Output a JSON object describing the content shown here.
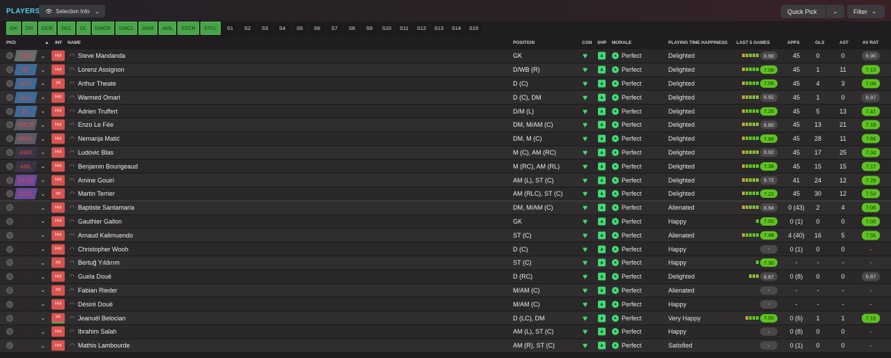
{
  "title": "PLAYERS",
  "selection_info": "Selection Info",
  "quick_pick": "Quick Pick",
  "filter": "Filter",
  "tabs": [
    {
      "label": "GK",
      "kind": "pos"
    },
    {
      "label": "DR",
      "kind": "pos"
    },
    {
      "label": "DCR",
      "kind": "pos"
    },
    {
      "label": "DCL",
      "kind": "pos"
    },
    {
      "label": "DL",
      "kind": "pos"
    },
    {
      "label": "DMCR",
      "kind": "pos"
    },
    {
      "label": "DMCL",
      "kind": "pos"
    },
    {
      "label": "AMR",
      "kind": "pos"
    },
    {
      "label": "AML",
      "kind": "pos"
    },
    {
      "label": "STCR",
      "kind": "pos"
    },
    {
      "label": "STCL",
      "kind": "pos"
    },
    {
      "label": "S1",
      "kind": "slot"
    },
    {
      "label": "S2",
      "kind": "slot"
    },
    {
      "label": "S3",
      "kind": "slot"
    },
    {
      "label": "S4",
      "kind": "slot"
    },
    {
      "label": "S5",
      "kind": "slot"
    },
    {
      "label": "S6",
      "kind": "slot"
    },
    {
      "label": "S7",
      "kind": "slot"
    },
    {
      "label": "S8",
      "kind": "slot"
    },
    {
      "label": "S9",
      "kind": "slot"
    },
    {
      "label": "S10",
      "kind": "slot"
    },
    {
      "label": "S11",
      "kind": "slot"
    },
    {
      "label": "S12",
      "kind": "slot"
    },
    {
      "label": "S13",
      "kind": "slot"
    },
    {
      "label": "S14",
      "kind": "slot"
    },
    {
      "label": "S15",
      "kind": "slot"
    }
  ],
  "headers": {
    "pkd": "PKD",
    "inf": "INF",
    "name": "NAME",
    "position": "POSITION",
    "con": "CON",
    "shp": "SHP",
    "morale": "MORALE",
    "happiness": "PLAYING TIME HAPPINESS",
    "last5": "LAST 5 GAMES",
    "apps": "APPS",
    "gls": "GLS",
    "ast": "AST",
    "avrat": "AV RAT"
  },
  "colors": {
    "pos_tab": "#47a447",
    "rating_green": "#5dc41f",
    "rating_grey": "#4a484a",
    "heart": "#3ddc74",
    "inf_red": "#d9534f",
    "accent": "#4fd1e8"
  },
  "players": [
    {
      "pkd": "GK",
      "pkd_color": "#6a6a6a",
      "inf": "Hol",
      "name": "Steve Mandanda",
      "position": "GK",
      "morale": "Perfect",
      "happiness": "Delighted",
      "bars": 5,
      "last5": "6.90",
      "last5_green": false,
      "apps": "45",
      "gls": "0",
      "ast": "0",
      "avrat": "6.90",
      "avrat_green": false
    },
    {
      "pkd": "DR",
      "pkd_color": "#3e6a96",
      "inf": "Hol",
      "name": "Lorenz Assignon",
      "position": "D/WB (R)",
      "morale": "Perfect",
      "happiness": "Delighted",
      "bars": 5,
      "last5": "7.08",
      "last5_green": true,
      "apps": "45",
      "gls": "1",
      "ast": "11",
      "avrat": "7.13",
      "avrat_green": true
    },
    {
      "pkd": "DCR",
      "pkd_color": "#3e6a96",
      "inf": "Int",
      "name": "Arthur Theate",
      "position": "D (C)",
      "morale": "Perfect",
      "happiness": "Delighted",
      "bars": 5,
      "last5": "7.06",
      "last5_green": true,
      "apps": "45",
      "gls": "4",
      "ast": "3",
      "avrat": "7.08",
      "avrat_green": true
    },
    {
      "pkd": "DCL",
      "pkd_color": "#3e6a96",
      "inf": "Hol",
      "name": "Warmed Omari",
      "position": "D (C), DM",
      "morale": "Perfect",
      "happiness": "Delighted",
      "bars": 5,
      "last5": "6.92",
      "last5_green": false,
      "apps": "45",
      "gls": "1",
      "ast": "0",
      "avrat": "6.97",
      "avrat_green": false
    },
    {
      "pkd": "DL",
      "pkd_color": "#3e6a96",
      "inf": "Hol",
      "name": "Adrien Truffert",
      "position": "D/M (L)",
      "morale": "Perfect",
      "happiness": "Delighted",
      "bars": 5,
      "last5": "7.20",
      "last5_green": true,
      "apps": "45",
      "gls": "5",
      "ast": "13",
      "avrat": "7.41",
      "avrat_green": true
    },
    {
      "pkd": "DMCR",
      "pkd_color": "#5a5a66",
      "inf": "Hol",
      "name": "Enzo Le Fée",
      "position": "DM, M/AM (C)",
      "morale": "Perfect",
      "happiness": "Delighted",
      "bars": 5,
      "last5": "6.80",
      "last5_green": false,
      "apps": "45",
      "gls": "13",
      "ast": "21",
      "avrat": "7.18",
      "avrat_green": true
    },
    {
      "pkd": "DMCL",
      "pkd_color": "#5a5a66",
      "inf": "Hol",
      "name": "Nemanja Matić",
      "position": "DM, M (C)",
      "morale": "Perfect",
      "happiness": "Delighted",
      "bars": 5,
      "last5": "7.88",
      "last5_green": true,
      "apps": "45",
      "gls": "28",
      "ast": "11",
      "avrat": "7.84",
      "avrat_green": true
    },
    {
      "pkd": "AMR",
      "pkd_color": "#3a3448",
      "inf": "Hol",
      "name": "Ludovic Blas",
      "position": "M (C), AM (RC)",
      "morale": "Perfect",
      "happiness": "Delighted",
      "bars": 5,
      "last5": "6.92",
      "last5_green": false,
      "apps": "45",
      "gls": "17",
      "ast": "25",
      "avrat": "7.34",
      "avrat_green": true
    },
    {
      "pkd": "AML",
      "pkd_color": "#3a3448",
      "inf": "Hol",
      "name": "Benjamin Bourigeaud",
      "position": "M (RC), AM (RL)",
      "morale": "Perfect",
      "happiness": "Delighted",
      "bars": 5,
      "last5": "7.38",
      "last5_green": true,
      "apps": "45",
      "gls": "15",
      "ast": "15",
      "avrat": "7.17",
      "avrat_green": true
    },
    {
      "pkd": "STCR",
      "pkd_color": "#6a4a9a",
      "inf": "Hol",
      "name": "Amine Gouiri",
      "position": "AM (L), ST (C)",
      "morale": "Perfect",
      "happiness": "Delighted",
      "bars": 5,
      "last5": "6.72",
      "last5_green": false,
      "apps": "41",
      "gls": "24",
      "ast": "12",
      "avrat": "7.29",
      "avrat_green": true
    },
    {
      "pkd": "STCL",
      "pkd_color": "#6a4a9a",
      "inf": "Int",
      "name": "Martin Terrier",
      "position": "AM (RLC), ST (C)",
      "morale": "Perfect",
      "happiness": "Delighted",
      "bars": 5,
      "last5": "7.22",
      "last5_green": true,
      "apps": "45",
      "gls": "30",
      "ast": "12",
      "avrat": "7.53",
      "avrat_green": true
    },
    {
      "pkd": "-",
      "pkd_color": "",
      "inf": "Hol",
      "name": "Baptiste Santamaria",
      "position": "DM, M/AM (C)",
      "morale": "Perfect",
      "happiness": "Alienated",
      "bars": 5,
      "last5": "6.94",
      "last5_green": false,
      "apps": "0 (43)",
      "gls": "2",
      "ast": "4",
      "avrat": "7.06",
      "avrat_green": true
    },
    {
      "pkd": "-",
      "pkd_color": "",
      "inf": "Hol",
      "name": "Gauthier Gallon",
      "position": "GK",
      "morale": "Perfect",
      "happiness": "Happy",
      "bars": 1,
      "last5": "7.00",
      "last5_green": true,
      "apps": "0 (1)",
      "gls": "0",
      "ast": "0",
      "avrat": "7.00",
      "avrat_green": true
    },
    {
      "pkd": "-",
      "pkd_color": "",
      "inf": "Hol",
      "name": "Arnaud Kalimuendo",
      "position": "ST (C)",
      "morale": "Perfect",
      "happiness": "Alienated",
      "bars": 5,
      "last5": "7.48",
      "last5_green": true,
      "apps": "4 (40)",
      "gls": "16",
      "ast": "5",
      "avrat": "7.55",
      "avrat_green": true
    },
    {
      "pkd": "-",
      "pkd_color": "",
      "inf": "Hol",
      "name": "Christopher Wooh",
      "position": "D (C)",
      "morale": "Perfect",
      "happiness": "Happy",
      "bars": 0,
      "last5": "-",
      "last5_green": false,
      "apps": "0 (1)",
      "gls": "0",
      "ast": "0",
      "avrat": "-",
      "avrat_green": false
    },
    {
      "pkd": "-",
      "pkd_color": "",
      "inf": "Int",
      "name": "Bertuğ Yıldırım",
      "position": "ST (C)",
      "morale": "Perfect",
      "happiness": "Happy",
      "bars": 1,
      "last5": "7.30",
      "last5_green": true,
      "apps": "-",
      "gls": "-",
      "ast": "-",
      "avrat": "-",
      "avrat_green": false
    },
    {
      "pkd": "-",
      "pkd_color": "",
      "inf": "Hol",
      "name": "Guela Doué",
      "position": "D (RC)",
      "morale": "Perfect",
      "happiness": "Delighted",
      "bars": 3,
      "last5": "6.87",
      "last5_green": false,
      "apps": "0 (8)",
      "gls": "0",
      "ast": "0",
      "avrat": "6.87",
      "avrat_green": false
    },
    {
      "pkd": "-",
      "pkd_color": "",
      "inf": "Int",
      "name": "Fabian Rieder",
      "position": "M/AM (C)",
      "morale": "Perfect",
      "happiness": "Alienated",
      "bars": 0,
      "last5": "-",
      "last5_green": false,
      "apps": "-",
      "gls": "-",
      "ast": "-",
      "avrat": "-",
      "avrat_green": false
    },
    {
      "pkd": "-",
      "pkd_color": "",
      "inf": "Hol",
      "name": "Désiré Doué",
      "position": "M/AM (C)",
      "morale": "Perfect",
      "happiness": "Happy",
      "bars": 0,
      "last5": "-",
      "last5_green": false,
      "apps": "-",
      "gls": "-",
      "ast": "-",
      "avrat": "-",
      "avrat_green": false
    },
    {
      "pkd": "-",
      "pkd_color": "",
      "inf": "Int",
      "name": "Jeanuël Belocian",
      "position": "D (LC), DM",
      "morale": "Perfect",
      "happiness": "Very Happy",
      "bars": 4,
      "last5": "7.00",
      "last5_green": true,
      "apps": "0 (6)",
      "gls": "1",
      "ast": "1",
      "avrat": "7.15",
      "avrat_green": true
    },
    {
      "pkd": "-",
      "pkd_color": "",
      "inf": "Hol",
      "name": "Ibrahim Salah",
      "position": "AM (L), ST (C)",
      "morale": "Perfect",
      "happiness": "Happy",
      "bars": 0,
      "last5": "-",
      "last5_green": false,
      "apps": "0 (8)",
      "gls": "0",
      "ast": "0",
      "avrat": "-",
      "avrat_green": false
    },
    {
      "pkd": "-",
      "pkd_color": "",
      "inf": "Hol",
      "name": "Mathis Lambourde",
      "position": "AM (R), ST (C)",
      "morale": "Perfect",
      "happiness": "Satisfied",
      "bars": 0,
      "last5": "-",
      "last5_green": false,
      "apps": "0 (1)",
      "gls": "0",
      "ast": "0",
      "avrat": "-",
      "avrat_green": false
    }
  ]
}
